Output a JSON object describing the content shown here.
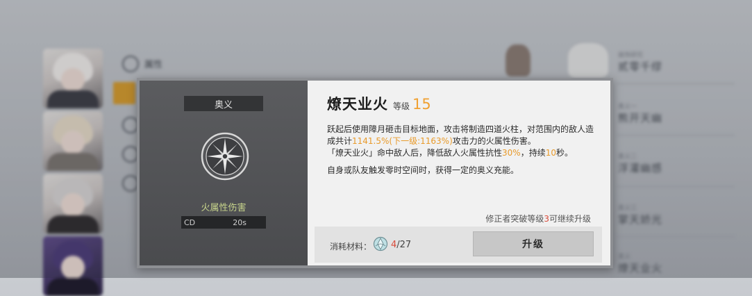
{
  "background": {
    "menu_item_top": "属性",
    "right_list": [
      {
        "tag": "装饰研究",
        "name": "贰零千缪"
      },
      {
        "tag": "奥义一",
        "name": "熊开天幽"
      },
      {
        "tag": "奥义二",
        "name": "浮灌幽感"
      },
      {
        "tag": "奥义三",
        "name": "掌天娇光"
      },
      {
        "tag": "奥义",
        "name": "燎天业火"
      }
    ]
  },
  "dialog": {
    "panel_header": "奥义",
    "skill_icon": "compass-star-icon",
    "element_label": "火属性伤害",
    "cd_label": "CD",
    "cd_value": "20s",
    "skill_name": "燎天业火",
    "level_label": "等级",
    "level_value": "15",
    "desc": {
      "l1_a": "跃起后使用障月砸击目标地面，攻击将制造四道火柱，对范围内的敌人造成共计",
      "l1_hl": "1141.5%(下一级:1163%)",
      "l1_b": "攻击力的火属性伤害。",
      "l2_a": "「燎天业火」命中敌人后，降低敌人火属性抗性",
      "l2_hl1": "30%",
      "l2_b": "，持续",
      "l2_hl2": "10",
      "l2_c": "秒。",
      "p2": "自身或队友触发零时空间时，获得一定的奥义充能。"
    },
    "upgrade_hint_a": "修正者突破等级",
    "upgrade_hint_num": "3",
    "upgrade_hint_b": "可继续升级",
    "material_label": "消耗材料：",
    "material_icon": "crystal-orb-icon",
    "material_have": "4",
    "material_need": "/27",
    "upgrade_button": "升级"
  },
  "colors": {
    "accent_orange": "#f0a030",
    "insufficient_red": "#d94a3a",
    "element_green": "#c8d58c"
  }
}
